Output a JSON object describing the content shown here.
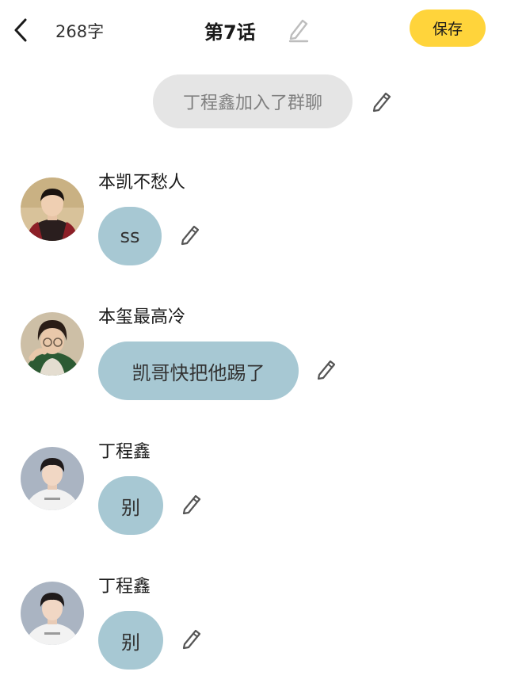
{
  "header": {
    "word_count": "268字",
    "title": "第7话",
    "save_label": "保存",
    "back_icon": "chevron-left-icon",
    "title_edit_icon": "pencil-icon"
  },
  "system_message": {
    "text": "丁程鑫加入了群聊",
    "edit_icon": "pencil-icon"
  },
  "messages": [
    {
      "sender": "本凯不愁人",
      "text": "ss",
      "avatar": "avatar-image"
    },
    {
      "sender": "本玺最高冷",
      "text": "凯哥快把他踢了",
      "avatar": "avatar-image"
    },
    {
      "sender": "丁程鑫",
      "text": "别",
      "avatar": "avatar-image"
    },
    {
      "sender": "丁程鑫",
      "text": "别",
      "avatar": "avatar-image"
    }
  ],
  "colors": {
    "save_button": "#ffd43b",
    "bubble": "#a7c8d3",
    "system_bubble": "#e5e5e5",
    "icon": "#555555"
  }
}
